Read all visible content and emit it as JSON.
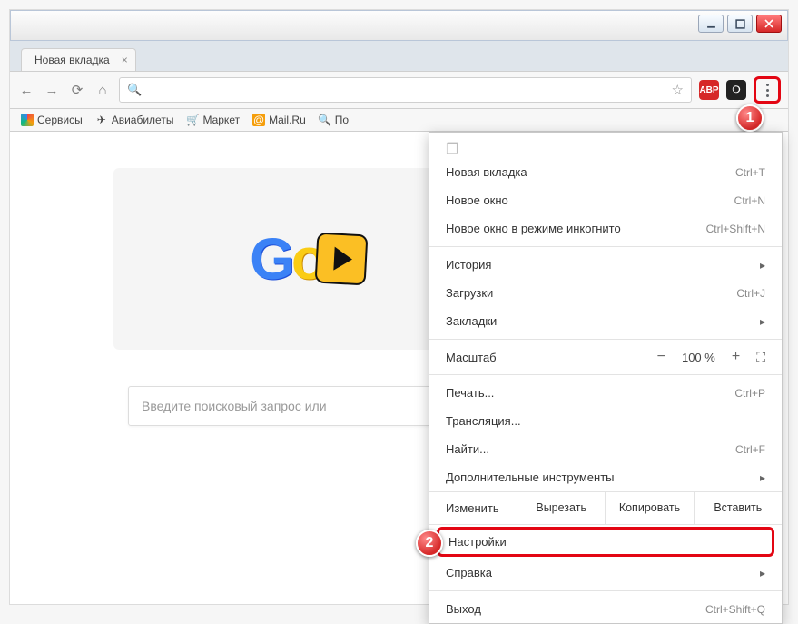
{
  "window": {
    "tab_title": "Новая вкладка"
  },
  "bookmarks": {
    "services": "Сервисы",
    "avia": "Авиабилеты",
    "market": "Маркет",
    "mailru": "Mail.Ru",
    "more": "По"
  },
  "content": {
    "search_placeholder": "Введите поисковый запрос или"
  },
  "menu": {
    "new_tab": "Новая вкладка",
    "new_tab_sc": "Ctrl+T",
    "new_window": "Новое окно",
    "new_window_sc": "Ctrl+N",
    "incognito": "Новое окно в режиме инкогнито",
    "incognito_sc": "Ctrl+Shift+N",
    "history": "История",
    "downloads": "Загрузки",
    "downloads_sc": "Ctrl+J",
    "bookmarks": "Закладки",
    "zoom_label": "Масштаб",
    "zoom_value": "100 %",
    "print": "Печать...",
    "print_sc": "Ctrl+P",
    "cast": "Трансляция...",
    "find": "Найти...",
    "find_sc": "Ctrl+F",
    "more_tools": "Дополнительные инструменты",
    "edit_label": "Изменить",
    "cut": "Вырезать",
    "copy": "Копировать",
    "paste": "Вставить",
    "settings": "Настройки",
    "help": "Справка",
    "exit": "Выход",
    "exit_sc": "Ctrl+Shift+Q"
  },
  "callouts": {
    "one": "1",
    "two": "2"
  }
}
